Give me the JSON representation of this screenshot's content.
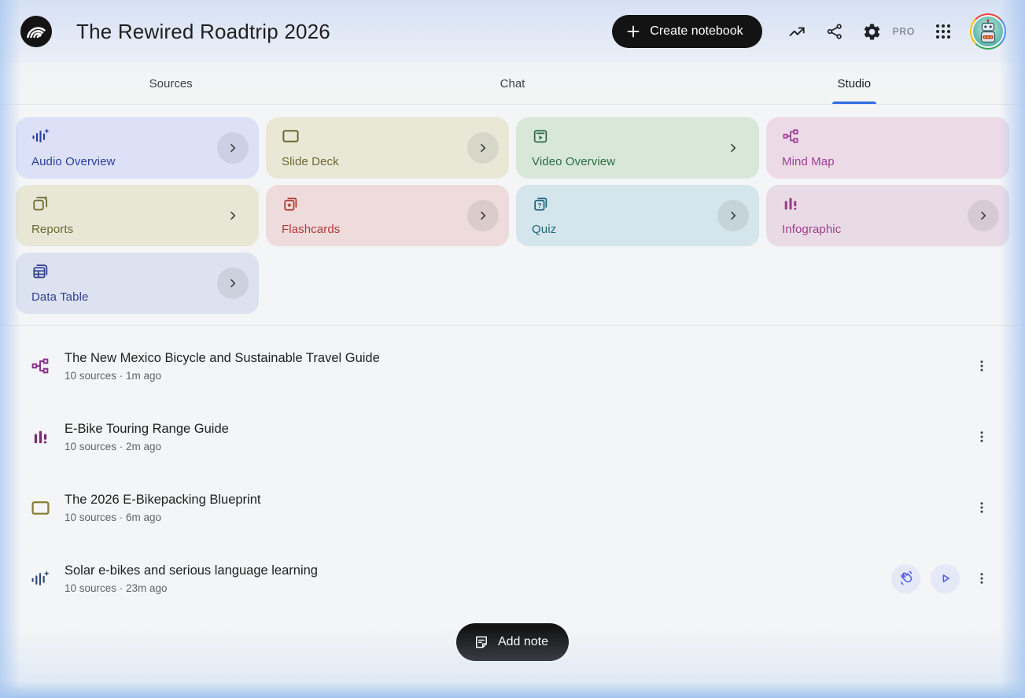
{
  "header": {
    "title": "The Rewired Roadtrip 2026",
    "create_notebook_label": "Create notebook",
    "pro_label": "PRO",
    "icons": [
      "notebooklm-logo",
      "plus-icon",
      "trending-up-icon",
      "share-icon",
      "settings-gear-icon",
      "apps-grid-icon",
      "avatar"
    ]
  },
  "tabs": [
    {
      "label": "Sources",
      "active": false
    },
    {
      "label": "Chat",
      "active": false
    },
    {
      "label": "Studio",
      "active": true
    }
  ],
  "studio_cards": [
    {
      "label": "Audio Overview",
      "icon": "audio-waveform-sparkle-icon",
      "chevron": "circle",
      "bg": "#dce1f8",
      "fg": "#2b3f9e"
    },
    {
      "label": "Slide Deck",
      "icon": "slide-deck-icon",
      "chevron": "circle",
      "bg": "#e9e8d7",
      "fg": "#6d6830"
    },
    {
      "label": "Video Overview",
      "icon": "video-overview-icon",
      "chevron": "plain",
      "bg": "#d7e8d9",
      "fg": "#2e6b45"
    },
    {
      "label": "Mind Map",
      "icon": "mind-map-icon",
      "chevron": "none",
      "bg": "#ecdbe7",
      "fg": "#a13d97"
    },
    {
      "label": "Reports",
      "icon": "report-sparkle-icon",
      "chevron": "plain",
      "bg": "#e8e7d6",
      "fg": "#6d6830"
    },
    {
      "label": "Flashcards",
      "icon": "flashcards-icon",
      "chevron": "circle",
      "bg": "#eedbdb",
      "fg": "#b03a33"
    },
    {
      "label": "Quiz",
      "icon": "quiz-cards-icon",
      "chevron": "circle",
      "bg": "#d4e5eb",
      "fg": "#20647c"
    },
    {
      "label": "Infographic",
      "icon": "infographic-bars-icon",
      "chevron": "circle",
      "bg": "#e9dbe6",
      "fg": "#a13d8a"
    },
    {
      "label": "Data Table",
      "icon": "data-table-icon",
      "chevron": "circle",
      "bg": "#dde2f0",
      "fg": "#32418f"
    }
  ],
  "artifacts": [
    {
      "icon": "mind-map-icon",
      "title": "The New Mexico Bicycle and Sustainable Travel Guide",
      "meta": "10 sources · 1m ago",
      "actions": [
        "kebab-menu-icon"
      ]
    },
    {
      "icon": "infographic-bars-icon",
      "title": "E-Bike Touring Range Guide",
      "meta": "10 sources · 2m ago",
      "actions": [
        "kebab-menu-icon"
      ]
    },
    {
      "icon": "slide-deck-icon",
      "title": "The 2026 E-Bikepacking Blueprint",
      "meta": "10 sources · 6m ago",
      "actions": [
        "kebab-menu-icon"
      ]
    },
    {
      "icon": "audio-waveform-sparkle-icon",
      "title": "Solar e-bikes and serious language learning",
      "meta": "10 sources · 23m ago",
      "actions": [
        "waving-hand-icon",
        "play-icon",
        "kebab-menu-icon"
      ]
    }
  ],
  "add_note_label": "Add note",
  "colors": {
    "tab_underline_blue": "#2e6be5",
    "black_button": "#131313",
    "header_gradient_top": "#d6e1f5",
    "page_background": "#f4f5f6",
    "audio_action_button_bg": "#e4e8f7",
    "audio_action_icon": "#4a58e8",
    "avatar_ring": [
      "#EA4335",
      "#4285F4",
      "#34A853",
      "#FBBC05"
    ]
  }
}
